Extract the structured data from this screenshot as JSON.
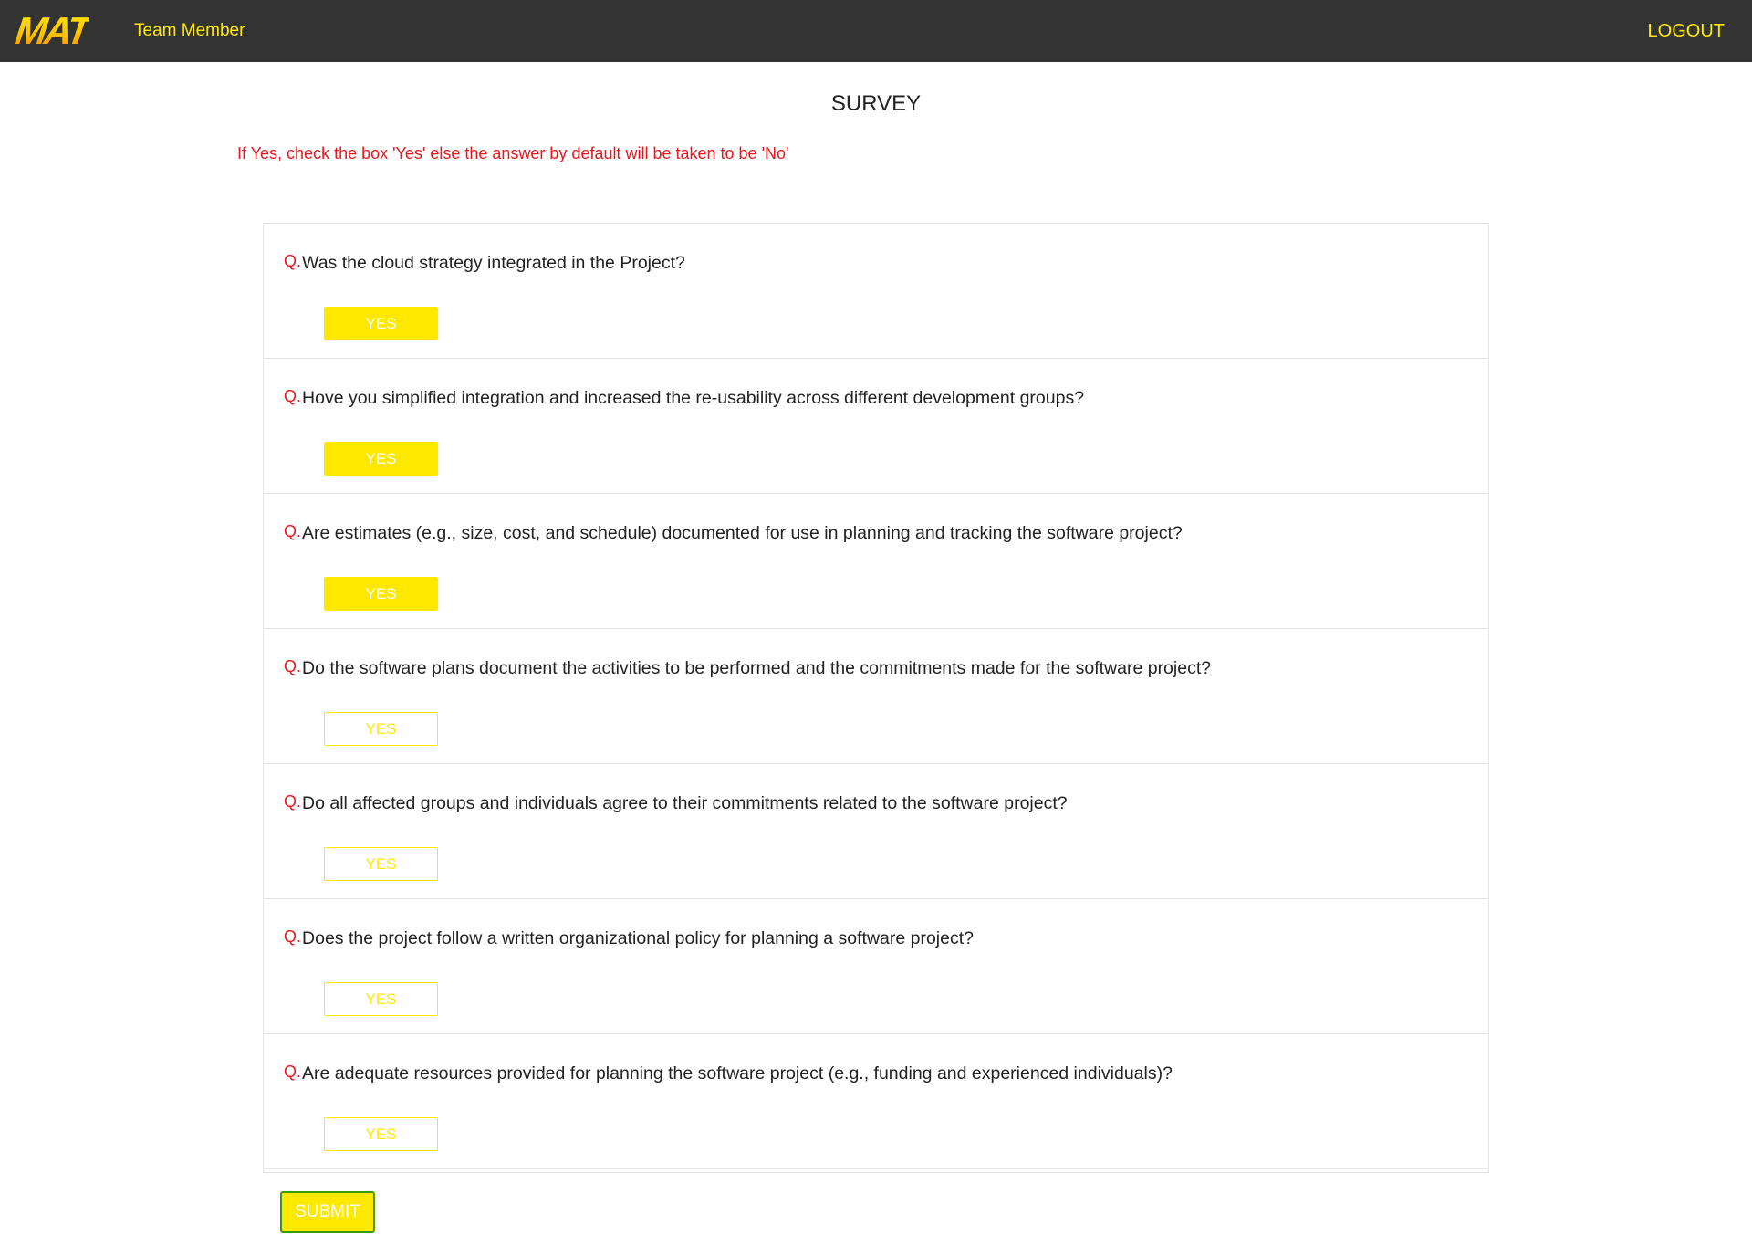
{
  "header": {
    "logo_text": "MAT",
    "role_label": "Team Member",
    "logout_label": "LOGOUT"
  },
  "survey": {
    "title": "SURVEY",
    "instruction": "If Yes, check the box 'Yes' else the answer by default will be taken to be 'No'",
    "question_prefix": "Q.",
    "yes_label": "YES",
    "questions": [
      {
        "text": "Was the cloud strategy integrated in the Project?",
        "answered_yes": true
      },
      {
        "text": "Hove you simplified integration and increased the re-usability across different development groups?",
        "answered_yes": true
      },
      {
        "text": "Are estimates (e.g., size, cost, and schedule) documented for use in planning and tracking the software project?",
        "answered_yes": true
      },
      {
        "text": "Do the software plans document the activities to be performed and the commitments made for the software project?",
        "answered_yes": false
      },
      {
        "text": "Do all affected groups and individuals agree to their commitments related to the software project?",
        "answered_yes": false
      },
      {
        "text": "Does the project follow a written organizational policy for planning a software project?",
        "answered_yes": false
      },
      {
        "text": "Are adequate resources provided for planning the software project (e.g., funding and experienced individuals)?",
        "answered_yes": false
      }
    ]
  },
  "submit_label": "SUBMIT",
  "colors": {
    "accent": "#FFE800",
    "header_background": "#333333",
    "instruction_text": "#E8171B",
    "submit_border": "#3A9A0A"
  }
}
